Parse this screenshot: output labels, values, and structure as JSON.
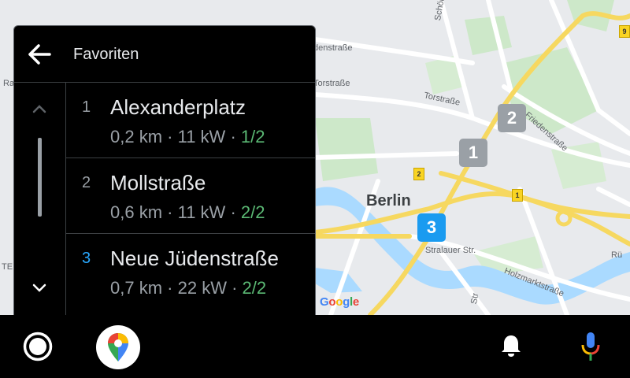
{
  "panel": {
    "title": "Favoriten",
    "items": [
      {
        "index": "1",
        "name": "Alexanderplatz",
        "distance": "0,2 km",
        "power": "11 kW",
        "availability": "1/2",
        "selected": false
      },
      {
        "index": "2",
        "name": "Mollstraße",
        "distance": "0,6 km",
        "power": "11 kW",
        "availability": "2/2",
        "selected": false
      },
      {
        "index": "3",
        "name": "Neue Jüdenstraße",
        "distance": "0,7 km",
        "power": "22 kW",
        "availability": "2/2",
        "selected": true
      }
    ],
    "separator": "·"
  },
  "map": {
    "city": "Berlin",
    "streets": {
      "torstrasse": "Torstraße",
      "torstrasse_left": "Torstraße",
      "denstrasse": "denstraße",
      "schoenhauser": "Schönhau",
      "friedenstrasse": "Friedenstraße",
      "stralauer": "Stralauer Str.",
      "holzmarkt": "Holzmarktstraße",
      "rand_left": "Ra",
      "rand_te": "TE",
      "rand_st": "Str",
      "rand_right": "Rü"
    },
    "route_shields": [
      "2",
      "1",
      "9"
    ],
    "markers": [
      {
        "label": "2",
        "color": "#9aa0a6"
      },
      {
        "label": "1",
        "color": "#9aa0a6"
      },
      {
        "label": "3",
        "color": "#1a9bf0"
      }
    ],
    "attribution": "Google"
  },
  "colors": {
    "panel_bg": "#000000",
    "availability": "#5bb974",
    "selected_index": "#29a8ff",
    "marker_active": "#1a9bf0",
    "marker_inactive": "#9aa0a6"
  },
  "bottom_bar": {
    "icons": [
      "home-icon",
      "google-maps-icon",
      "notification-bell-icon",
      "microphone-icon"
    ]
  }
}
